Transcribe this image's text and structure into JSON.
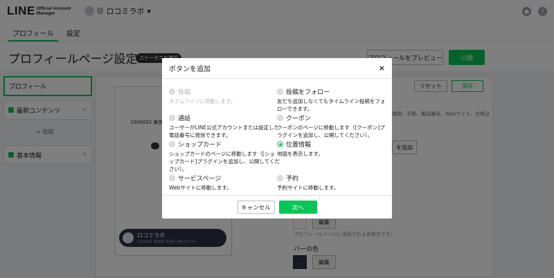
{
  "header": {
    "logo_main": "LINE",
    "logo_sub_1": "Official Account",
    "logo_sub_2": "Manager",
    "account_name": "ロコミラボ",
    "account_caret": "▾",
    "help_icon": "?"
  },
  "tabs": [
    {
      "label": "プロフィール",
      "active": true
    },
    {
      "label": "設定",
      "active": false
    }
  ],
  "page": {
    "title": "プロフィールページ設定",
    "status_chip": "ステータスを確認",
    "preview_button": "プロフィールをプレビュー",
    "publish_button": "公開",
    "reset_button": "リセット",
    "save_button": "保存"
  },
  "sidebar": {
    "items": [
      {
        "label": "プロフィール",
        "active": true
      },
      {
        "label": "最新コンテンツ",
        "checked": true
      },
      {
        "label": "基本情報",
        "checked": true
      }
    ],
    "add_label": "+ 追加"
  },
  "preview": {
    "postal_address": "1500002 東京都",
    "chip_name": "ロコミラボ",
    "chip_sub": "1500002 東京都 渋谷区 渋谷3-17-4..."
  },
  "settings": {
    "bar_color_label": "バーの色",
    "edit_label": "編集",
    "hint": "プロフィールページに適用される背景色です。",
    "partial_text": "時間、予算、電話番号、Webサイト、住所は",
    "partial_button": "を追加"
  },
  "modal": {
    "title": "ボタンを追加",
    "close_icon": "×",
    "options": [
      {
        "label": "投稿",
        "desc": "タイムラインに移動します。",
        "disabled": true,
        "checked": false
      },
      {
        "label": "投稿をフォロー",
        "desc": "友だち追加しなくてもタイムライン投稿をフォローできます。",
        "disabled": false,
        "checked": false
      },
      {
        "label": "通話",
        "desc": "ユーザーがLINE公式アカウントまたは設定した電話番号に発信できます。",
        "disabled": false,
        "checked": false
      },
      {
        "label": "クーポン",
        "desc": "クーポンのページに移動します（[クーポン]プラグインを追加し、公開してください）。",
        "disabled": false,
        "checked": false
      },
      {
        "label": "ショップカード",
        "desc": "ショップカードのページに移動します（[ショップカード]プラグインを追加し、公開してください）。",
        "disabled": false,
        "checked": false
      },
      {
        "label": "位置情報",
        "desc": "地図を表示します。",
        "disabled": false,
        "checked": true
      },
      {
        "label": "サービスページ",
        "desc": "Webサイトに移動します。",
        "disabled": false,
        "checked": false
      },
      {
        "label": "予約",
        "desc": "予約サイトに移動します。",
        "disabled": false,
        "checked": false
      }
    ],
    "cancel_button": "キャンセル",
    "next_button": "次へ"
  },
  "colors": {
    "brand_green": "#06c755",
    "overlay": "rgba(0,0,0,0.5)",
    "bar_color": "#2b3245"
  }
}
